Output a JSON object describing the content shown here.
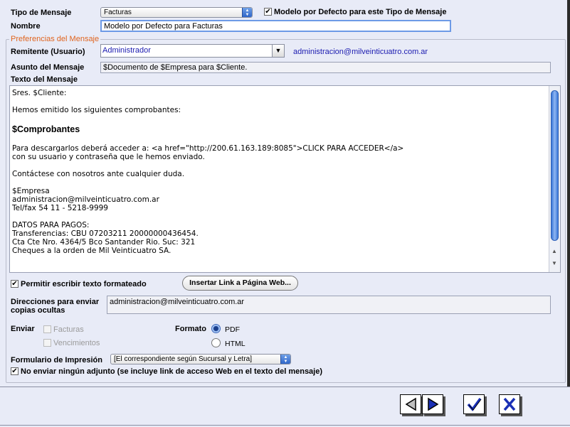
{
  "form": {
    "tipo_label": "Tipo de Mensaje",
    "tipo_value": "Facturas",
    "default_model_label": "Modelo por Defecto para este Tipo de Mensaje",
    "nombre_label": "Nombre",
    "nombre_value": "Modelo por Defecto para Facturas"
  },
  "prefs": {
    "legend": "Preferencias del Mensaje",
    "remitente_label": "Remitente (Usuario)",
    "remitente_value": "Administrador",
    "remitente_email": "administracion@milveinticuatro.com.ar",
    "asunto_label": "Asunto del Mensaje",
    "asunto_value": "$Documento de $Empresa para $Cliente.",
    "texto_label": "Texto del Mensaje",
    "message_lines": [
      "Sres. $Cliente:",
      "",
      "Hemos emitido los siguientes comprobantes:",
      "",
      "",
      "",
      "Para descargarlos deberá acceder a: <a href=\"http://200.61.163.189:8085\">CLICK PARA ACCEDER</a>",
      "con su usuario y contraseña que le hemos enviado.",
      "",
      "Contáctese con nosotros ante cualquier duda.",
      "",
      "$Empresa",
      "administracion@milveinticuatro.com.ar",
      "Tel/fax 54 11 - 5218-9999",
      "",
      "DATOS PARA PAGOS:",
      "Transferencias: CBU 07203211 20000000436454.",
      "Cta Cte Nro. 4364/5 Bco Santander Rio. Suc: 321",
      "Cheques a la orden de Mil Veinticuatro SA."
    ],
    "message_bold_line": "$Comprobantes",
    "formatted_label": "Permitir escribir texto formateado",
    "insert_link_label": "Insertar Link a Página Web...",
    "bcc_label_1": "Direcciones para enviar",
    "bcc_label_2": "copias ocultas",
    "bcc_value": "administracion@milveinticuatro.com.ar",
    "enviar_label": "Enviar",
    "facturas_label": "Facturas",
    "vencimientos_label": "Vencimientos",
    "formato_label": "Formato",
    "pdf_label": "PDF",
    "html_label": "HTML",
    "formato_selected": "PDF",
    "formulario_label": "Formulario de Impresión",
    "formulario_value": "[El correspondiente según Sucursal y Letra]",
    "no_adjunto_label": "No enviar ningún adjunto (se incluye link de acceso Web en el texto del mensaje)"
  },
  "colors": {
    "legend": "#e0641e",
    "link_blue": "#1b1bb0",
    "background": "#e8ebf7"
  },
  "icons": {
    "prev": "left-arrow-icon",
    "next": "right-arrow-icon",
    "ok": "checkmark-icon",
    "cancel": "x-icon"
  }
}
